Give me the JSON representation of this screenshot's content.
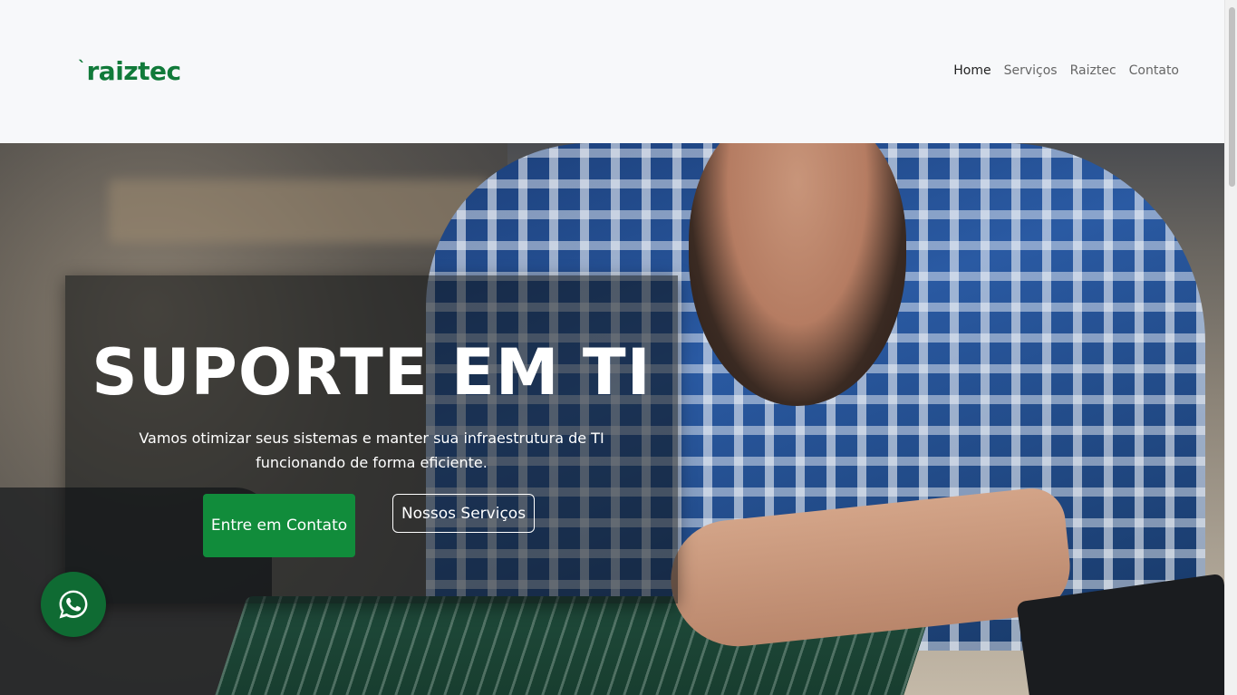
{
  "brand": {
    "logo_text": "raiztec",
    "logo_mark": "`",
    "color": "#117a3a"
  },
  "nav": {
    "items": [
      {
        "label": "Home",
        "active": true
      },
      {
        "label": "Serviços",
        "active": false
      },
      {
        "label": "Raiztec",
        "active": false
      },
      {
        "label": "Contato",
        "active": false
      }
    ]
  },
  "hero": {
    "title": "SUPORTE EM TI",
    "subtitle": "Vamos otimizar seus sistemas e manter sua infraestrutura de TI funcionando de forma eficiente.",
    "primary_button": "Entre em Contato",
    "secondary_button": "Nossos Serviços",
    "accent_color": "#118c3b"
  },
  "floating": {
    "icon": "whatsapp-icon"
  }
}
